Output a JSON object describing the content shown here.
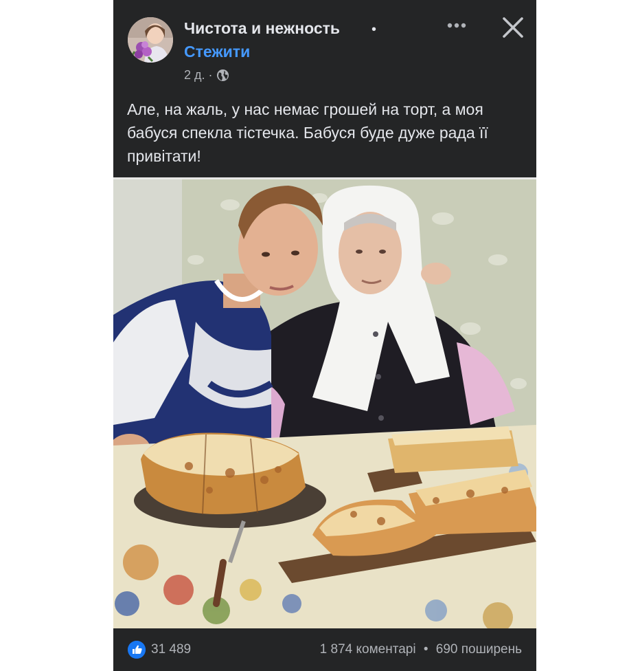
{
  "post": {
    "author": {
      "name": "Чистота и нежность",
      "name_separator": "•",
      "follow_label": "Стежити",
      "avatar_icon": "avatar-photo"
    },
    "meta": {
      "time": "2 д.",
      "separator": "·",
      "audience_icon": "globe-icon"
    },
    "actions": {
      "more_icon": "ellipsis-icon",
      "close_icon": "close-icon"
    },
    "caption": "Але, на жаль, у нас немає грошей на торт, а моя бабуся спекла тістечка. Бабуся буде дуже рада її привітати!",
    "photo": {
      "description_icon": "photo"
    },
    "footer": {
      "like_icon": "like-icon",
      "reaction_count": "31 489",
      "comments": "1 874 коментарі",
      "separator": "•",
      "shares": "690 поширень"
    }
  },
  "colors": {
    "background": "#242526",
    "text": "#e4e6eb",
    "secondary_text": "#b0b3b8",
    "link": "#4599ff",
    "like": "#1877f2"
  }
}
